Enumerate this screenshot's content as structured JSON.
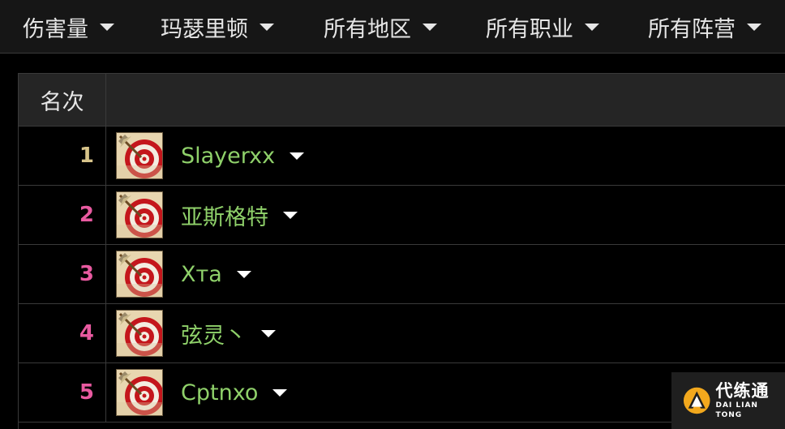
{
  "filters": [
    {
      "label": "伤害量"
    },
    {
      "label": "玛瑟里顿"
    },
    {
      "label": "所有地区"
    },
    {
      "label": "所有职业"
    },
    {
      "label": "所有阵营"
    }
  ],
  "table": {
    "header_rank": "名次",
    "rows": [
      {
        "rank": "1",
        "name": "Slayerxx",
        "rank_color": "#d7c48a",
        "icon": "hunter-class-icon"
      },
      {
        "rank": "2",
        "name": "亚斯格特",
        "rank_color": "#e85aa0",
        "icon": "hunter-class-icon"
      },
      {
        "rank": "3",
        "name": "Xта",
        "rank_color": "#e85aa0",
        "icon": "hunter-class-icon"
      },
      {
        "rank": "4",
        "name": "弦灵丶",
        "rank_color": "#e85aa0",
        "icon": "hunter-class-icon"
      },
      {
        "rank": "5",
        "name": "Cptnxo",
        "rank_color": "#e85aa0",
        "icon": "hunter-class-icon"
      }
    ]
  },
  "colors": {
    "player_name": "#8fd16a",
    "background": "#000000",
    "header_bg": "#252525"
  },
  "watermark": {
    "cn": "代练通",
    "en": "DAI LIAN TONG"
  }
}
